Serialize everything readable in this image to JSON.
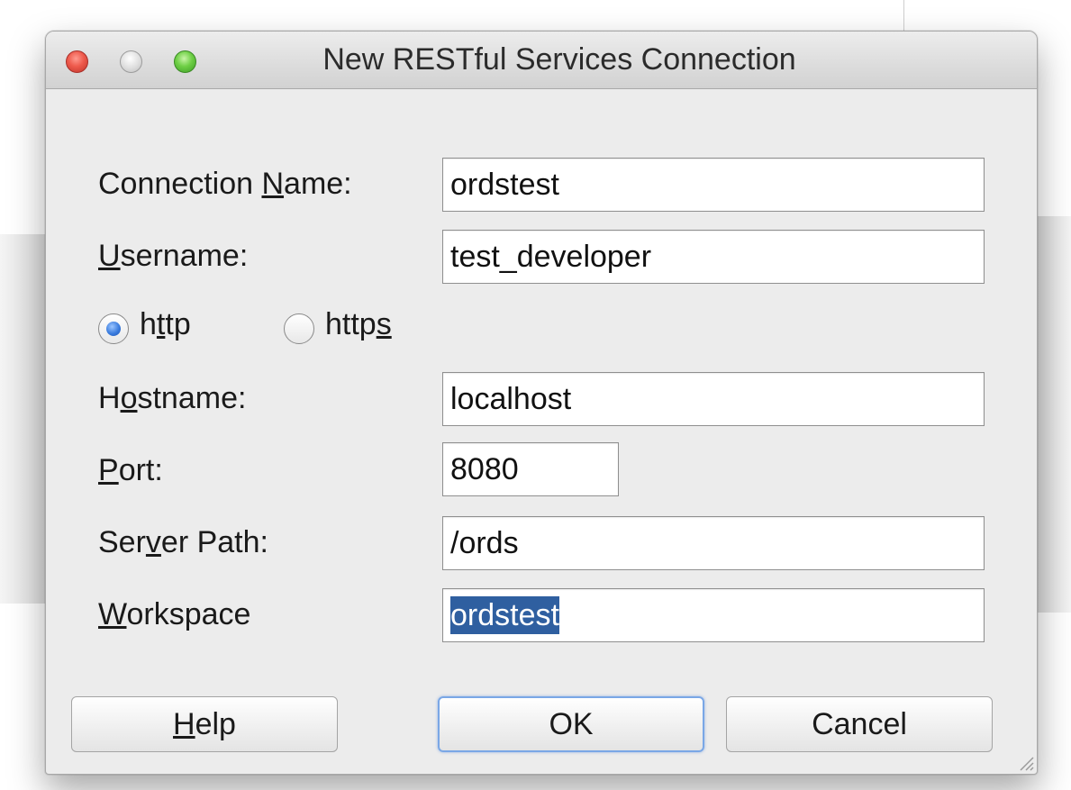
{
  "window": {
    "title": "New RESTful Services Connection"
  },
  "form": {
    "connection_name": {
      "label_pre": "Connection ",
      "label_mn": "N",
      "label_post": "ame:",
      "value": "ordstest"
    },
    "username": {
      "label_pre": "",
      "label_mn": "U",
      "label_post": "sername:",
      "value": "test_developer"
    },
    "protocol": {
      "http": {
        "pre": "h",
        "mn": "t",
        "post": "tp",
        "checked": true
      },
      "https": {
        "pre": "http",
        "mn": "s",
        "post": "",
        "checked": false
      }
    },
    "hostname": {
      "label_pre": "H",
      "label_mn": "o",
      "label_post": "stname:",
      "value": "localhost"
    },
    "port": {
      "label_pre": "",
      "label_mn": "P",
      "label_post": "ort:",
      "value": "8080"
    },
    "server_path": {
      "label_pre": "Ser",
      "label_mn": "v",
      "label_post": "er Path:",
      "value": "/ords"
    },
    "workspace": {
      "label_pre": "",
      "label_mn": "W",
      "label_post": "orkspace",
      "value": "ordstest"
    }
  },
  "buttons": {
    "help": {
      "pre": "",
      "mn": "H",
      "post": "elp"
    },
    "ok": "OK",
    "cancel": "Cancel"
  },
  "colors": {
    "selection": "#2f5fa0",
    "radio_checked": "#3a7cde",
    "default_button_ring": "#7aa7e6"
  }
}
